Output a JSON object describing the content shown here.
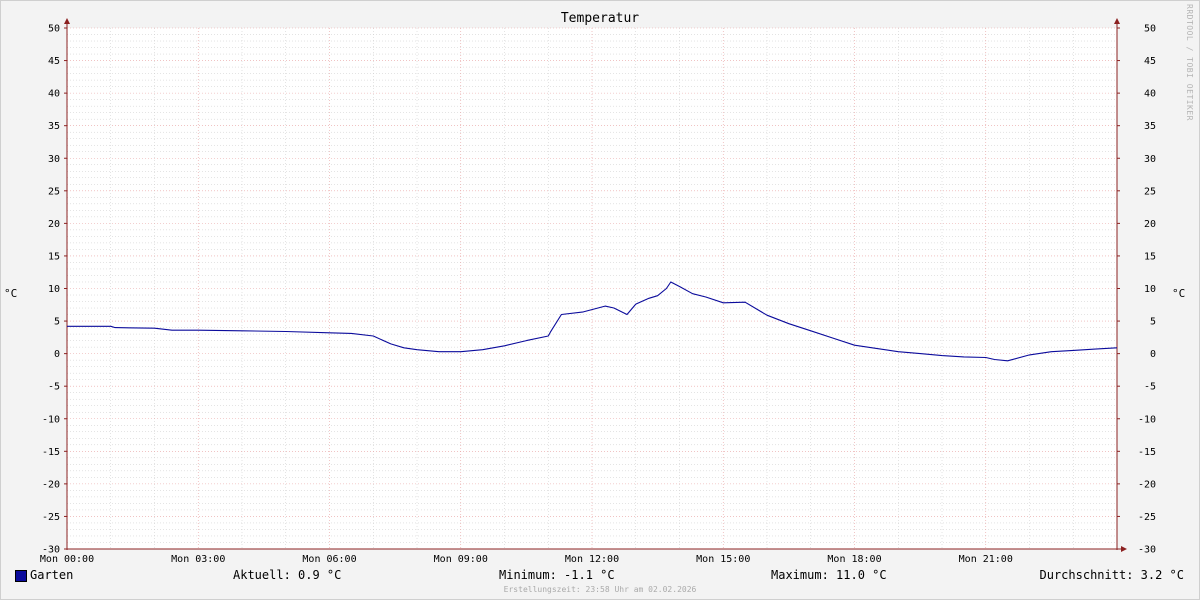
{
  "chart_data": {
    "type": "line",
    "title": "Temperatur",
    "ylabel": "°C",
    "ylim": [
      -30,
      50
    ],
    "y_ticks": [
      "50",
      "45",
      "40",
      "35",
      "30",
      "25",
      "20",
      "15",
      "10",
      "5",
      "0",
      "-5",
      "-10",
      "-15",
      "-20",
      "-25",
      "-30"
    ],
    "x_ticks": [
      "Mon 00:00",
      "Mon 03:00",
      "Mon 06:00",
      "Mon 09:00",
      "Mon 12:00",
      "Mon 15:00",
      "Mon 18:00",
      "Mon 21:00"
    ],
    "xlim_hours": [
      0,
      24
    ],
    "grid": true,
    "legend_placement": "bottom",
    "series": [
      {
        "name": "Garten",
        "color": "#0b0b9c",
        "x_hours": [
          0,
          1.0,
          1.1,
          2.0,
          2.4,
          3.0,
          4.0,
          5.0,
          6.0,
          6.5,
          7.0,
          7.4,
          7.7,
          8.0,
          8.5,
          9.0,
          9.5,
          10.0,
          10.5,
          11.0,
          11.05,
          11.3,
          11.8,
          12.3,
          12.5,
          12.8,
          13.0,
          13.3,
          13.5,
          13.7,
          13.8,
          14.0,
          14.3,
          14.6,
          15.0,
          15.5,
          16.0,
          16.5,
          17.0,
          17.5,
          18.0,
          18.5,
          19.0,
          19.5,
          20.0,
          20.5,
          21.0,
          21.2,
          21.5,
          22.0,
          22.5,
          23.0,
          23.5,
          24.0
        ],
        "values": [
          4.2,
          4.2,
          4.0,
          3.9,
          3.6,
          3.6,
          3.5,
          3.4,
          3.2,
          3.1,
          2.7,
          1.5,
          0.9,
          0.6,
          0.3,
          0.3,
          0.6,
          1.2,
          2.0,
          2.7,
          3.3,
          6.0,
          6.4,
          7.3,
          7.0,
          6.0,
          7.6,
          8.5,
          8.9,
          10.0,
          11.0,
          10.3,
          9.2,
          8.7,
          7.8,
          7.9,
          5.9,
          4.6,
          3.5,
          2.4,
          1.3,
          0.8,
          0.3,
          0.0,
          -0.3,
          -0.5,
          -0.6,
          -0.9,
          -1.1,
          -0.2,
          0.3,
          0.5,
          0.7,
          0.9
        ]
      }
    ]
  },
  "legend": {
    "series_name": "Garten",
    "current": "Aktuell: 0.9 °C",
    "minimum": "Minimum: -1.1 °C",
    "maximum": "Maximum: 11.0 °C",
    "average": "Durchschnitt: 3.2 °C"
  },
  "watermark": "RRDTOOL / TOBI OETIKER",
  "footer": "Erstellungszeit: 23:58 Uhr am 02.02.2026",
  "colors": {
    "background": "#f3f3f3",
    "plot_background": "#ffffff",
    "major_grid": "#e8a0a0",
    "minor_grid": "#c8c8c8",
    "axis": "#8b2020",
    "series": "#0b0b9c"
  }
}
